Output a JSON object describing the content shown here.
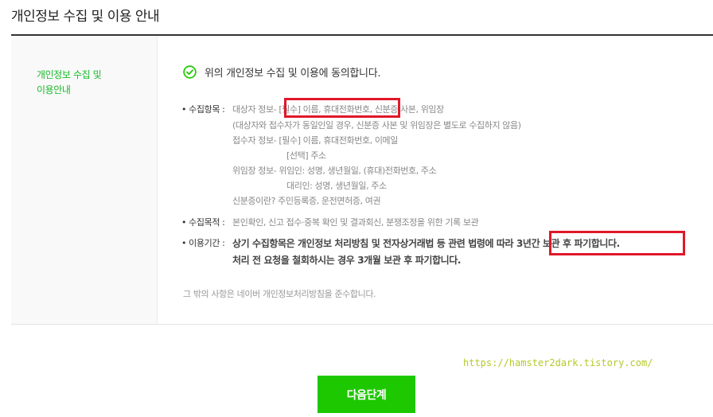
{
  "page": {
    "title": "개인정보 수집 및 이용 안내"
  },
  "sidebar": {
    "title_line1": "개인정보 수집 및",
    "title_line2": "이용안내"
  },
  "agreement": {
    "text": "위의 개인정보 수집 및 이용에 동의합니다."
  },
  "collect_items": {
    "label": "• 수집항목 :",
    "lines": [
      "대상자 정보- [필수] 이름, 휴대전화번호, 신분증 사본, 위임장",
      "(대상자와 접수자가 동일인일 경우, 신분증 사본 및 위임장은 별도로 수집하지 않음)",
      "접수자 정보- [필수] 이름, 휴대전화번호, 이메일",
      "[선택] 주소",
      "위임장 정보- 위임인: 성명, 생년월일, (휴대)전화번호, 주소",
      "대리인: 성명, 생년월일, 주소",
      "신분증이란? 주민등록증, 운전면허증, 여권"
    ]
  },
  "purpose": {
    "label": "• 수집목적 :",
    "text": "본인확인, 신고 접수·중복 확인 및 결과회신, 분쟁조정을 위한 기록 보관"
  },
  "retention": {
    "label": "• 이용기간 :",
    "line1": "상기 수집항목은 개인정보 처리방침 및 전자상거래법 등 관련 법령에 따라 3년간 보관 후 파기합니다.",
    "line2": "처리 전 요청을 철회하시는 경우 3개월 보관 후 파기합니다."
  },
  "footer_note": "그 밖의 사항은 네이버 개인정보처리방침을 준수합니다.",
  "watermark": "https://hamster2dark.tistory.com/",
  "next_button": {
    "label": "다음단계"
  },
  "colors": {
    "accent": "#1ec800",
    "highlight": "#e0182a",
    "sidebar_title": "#19b92a"
  }
}
